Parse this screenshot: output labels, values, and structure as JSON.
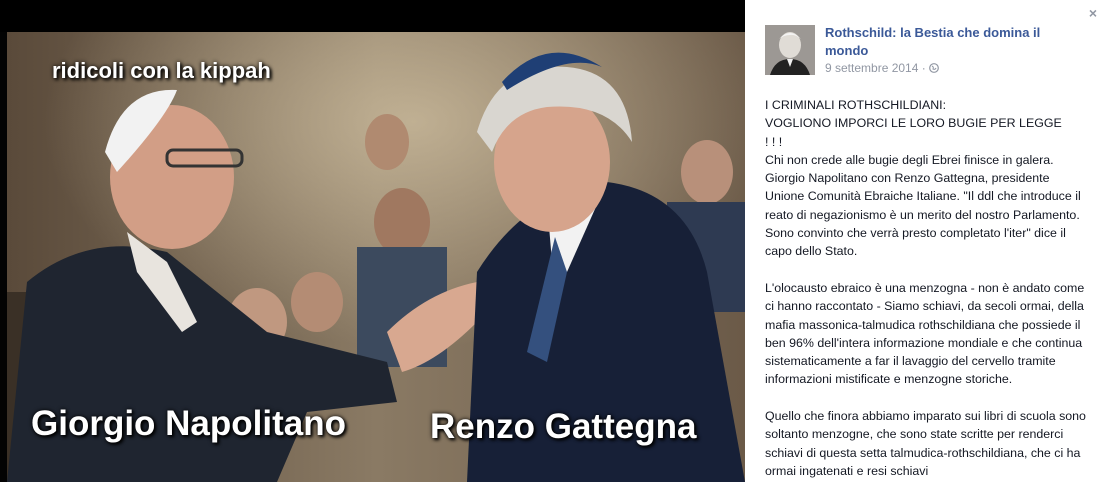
{
  "photo": {
    "caption_top": "ridicoli con la kippah",
    "caption_left": "Giorgio Napolitano",
    "caption_right": "Renzo Gattegna"
  },
  "post": {
    "page_name": "Rothschild: la Bestia che domina il mondo",
    "date": "9 settembre 2014",
    "separator": "·",
    "close_glyph": "×",
    "body": "I CRIMINALI ROTHSCHILDIANI:\nVOGLIONO IMPORCI LE LORO BUGIE PER LEGGE\n! ! !\nChi non crede alle bugie degli Ebrei finisce in galera.\nGiorgio Napolitano con Renzo Gattegna, presidente Unione Comunità Ebraiche Italiane. \"Il ddl che introduce il reato di negazionismo è un merito del nostro Parlamento. Sono convinto che verrà presto completato l'iter\" dice il capo dello Stato.\n\nL'olocausto ebraico è una menzogna - non è andato come ci hanno raccontato - Siamo schiavi, da secoli ormai, della mafia massonica-talmudica rothschildiana che possiede il ben 96% dell'intera informazione mondiale e che continua sistematicamente a far il lavaggio del cervello tramite informazioni mistificate e menzogne storiche.\n\nQuello che finora abbiamo imparato sui libri di scuola sono soltanto menzogne, che sono state scritte per renderci schiavi di questa setta talmudica-rothschildiana, che ci ha ormai ingatenati e resi schiavi"
  },
  "icons": {
    "close": "close-icon",
    "globe": "globe-icon",
    "avatar": "avatar"
  },
  "colors": {
    "link": "#3b5998",
    "meta": "#9197a3",
    "text": "#141823",
    "background_dark": "#000000"
  }
}
